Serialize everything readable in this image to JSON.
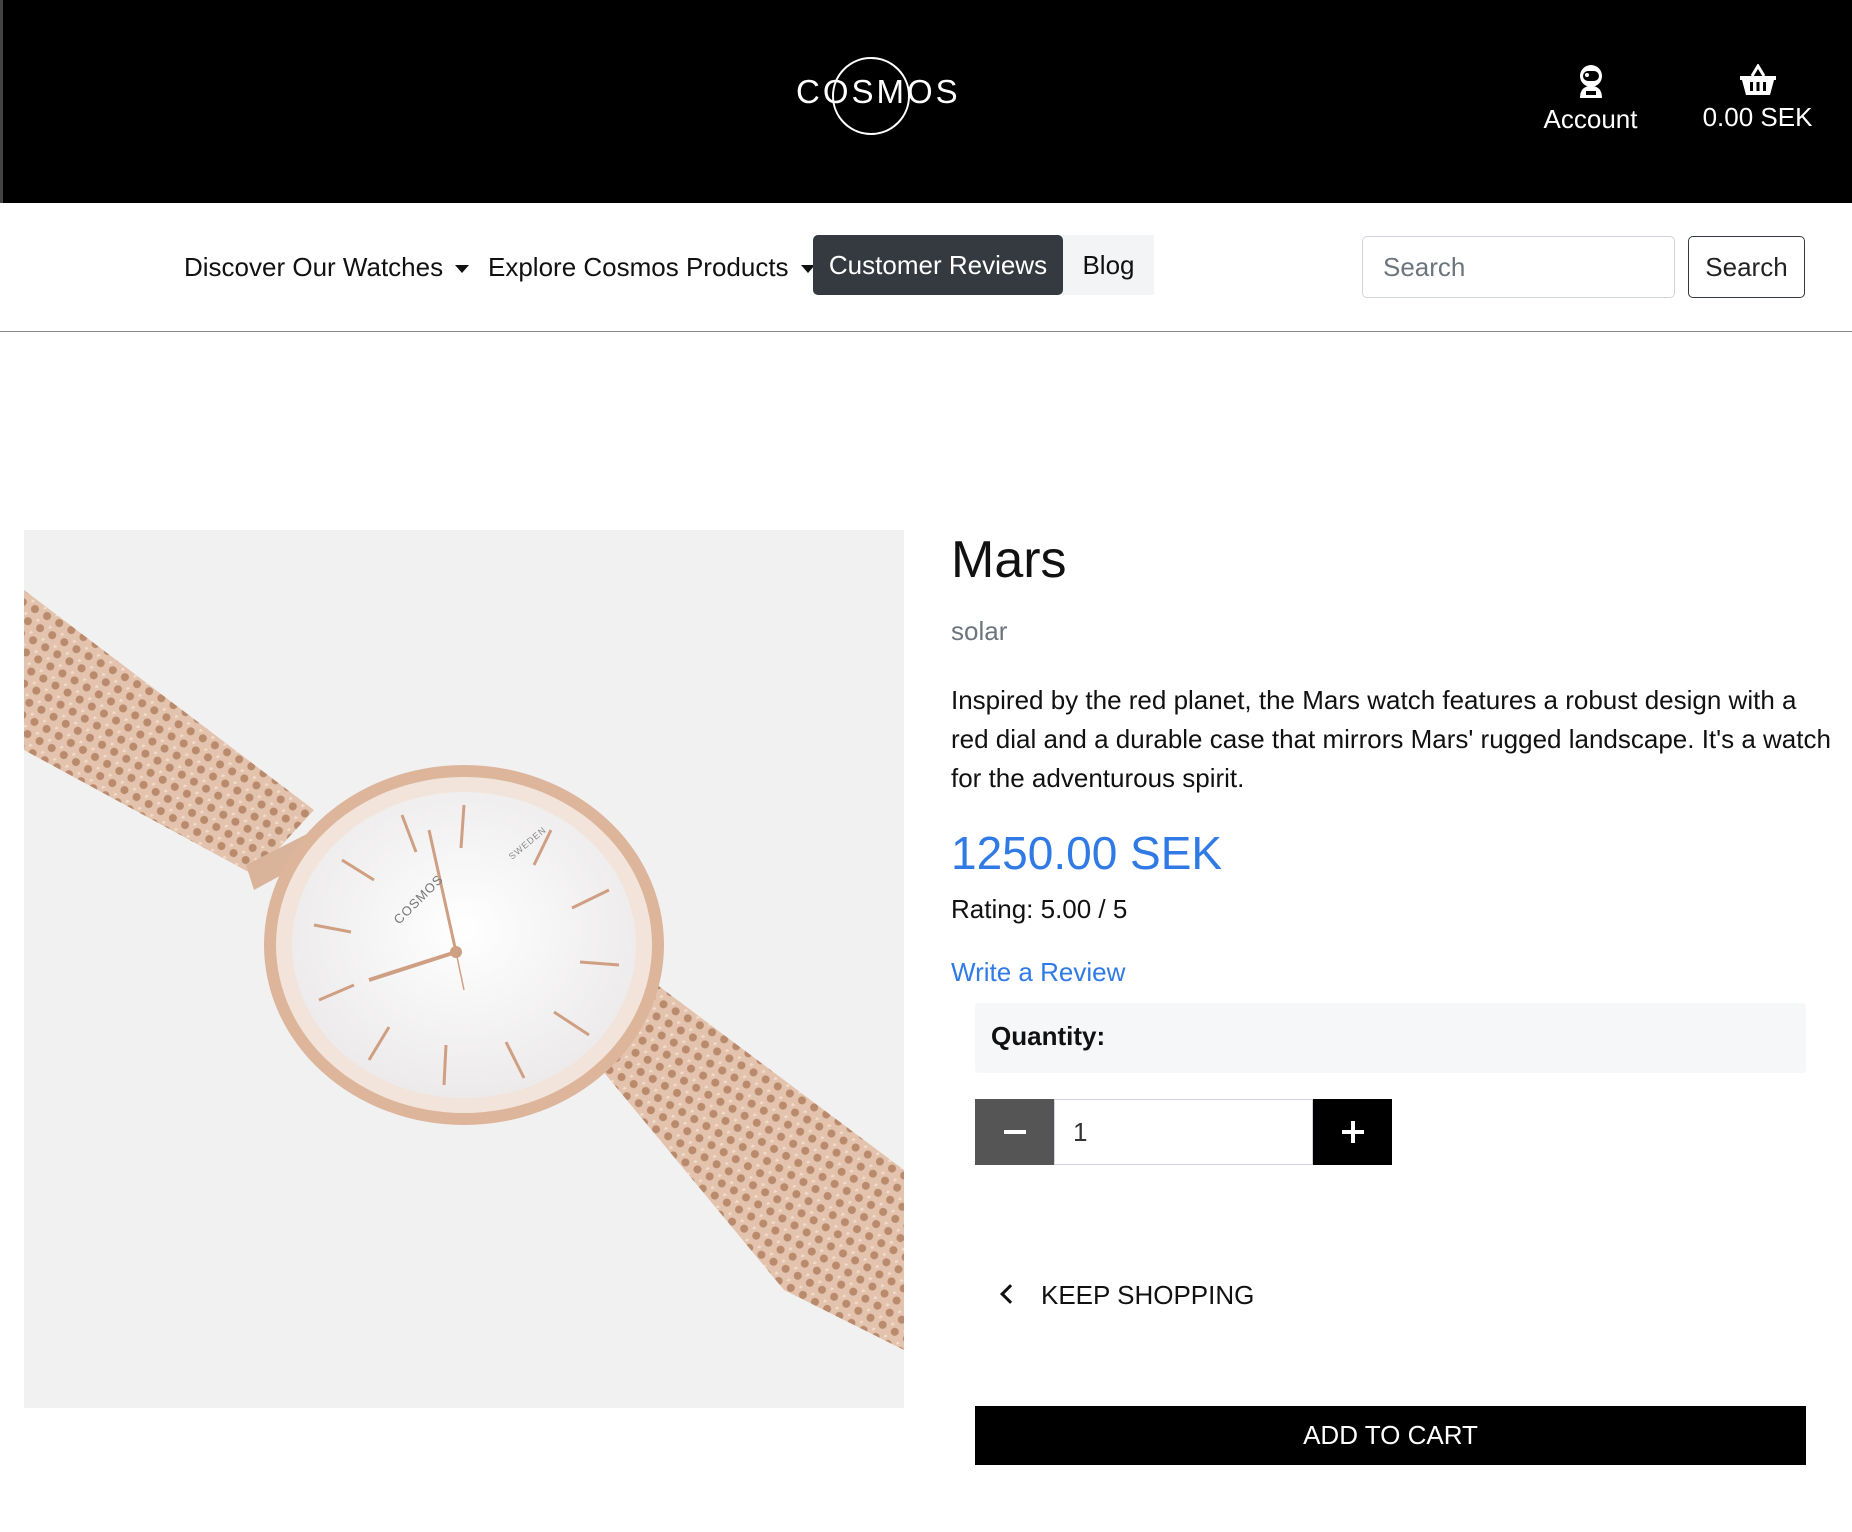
{
  "header": {
    "brand": "COSMOS",
    "account_label": "Account",
    "cart_total": "0.00 SEK",
    "icons": {
      "account": "astronaut-icon",
      "cart": "basket-icon"
    }
  },
  "nav": {
    "watches": "Discover Our Watches",
    "products": "Explore Cosmos Products",
    "reviews": "Customer Reviews",
    "blog": "Blog",
    "search_placeholder": "Search",
    "search_button": "Search"
  },
  "product": {
    "name": "Mars",
    "category": "solar",
    "description": "Inspired by the red planet, the Mars watch features a robust design with a red dial and a durable case that mirrors Mars' rugged landscape. It's a watch for the adventurous spirit.",
    "price": "1250.00 SEK",
    "rating": "Rating: 5.00 / 5",
    "write_review": "Write a Review",
    "image_dial_text": {
      "brand": "COSMOS",
      "origin": "SWEDEN"
    }
  },
  "purchase": {
    "quantity_label": "Quantity:",
    "quantity_value": "1",
    "keep_shopping": "KEEP SHOPPING",
    "add_to_cart": "ADD TO CART"
  },
  "colors": {
    "header_bg": "#000000",
    "accent_blue": "#2f7ae5",
    "active_nav_bg": "#343a40",
    "rose_gold": "#d4a88c"
  }
}
